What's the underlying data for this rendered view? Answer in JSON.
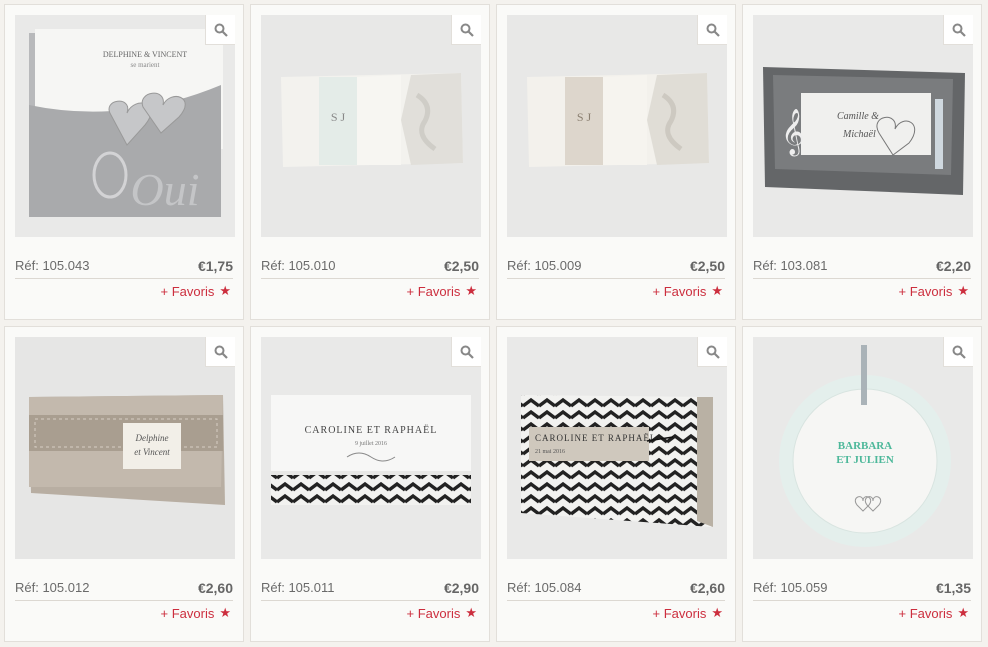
{
  "products": [
    {
      "ref": "Réf: 105.043",
      "price": "€1,75",
      "fav": "+ Favoris",
      "img": {
        "t1": "DELPHINE & VINCENT",
        "t2": "se marient",
        "t3": "Oui"
      }
    },
    {
      "ref": "Réf: 105.010",
      "price": "€2,50",
      "fav": "+ Favoris",
      "img": {
        "t1": "S J"
      }
    },
    {
      "ref": "Réf: 105.009",
      "price": "€2,50",
      "fav": "+ Favoris",
      "img": {
        "t1": "S J"
      }
    },
    {
      "ref": "Réf: 103.081",
      "price": "€2,20",
      "fav": "+ Favoris",
      "img": {
        "t1": "Camille &",
        "t2": "Michaël"
      }
    },
    {
      "ref": "Réf: 105.012",
      "price": "€2,60",
      "fav": "+ Favoris",
      "img": {
        "t1": "Delphine",
        "t2": "et Vincent"
      }
    },
    {
      "ref": "Réf: 105.011",
      "price": "€2,90",
      "fav": "+ Favoris",
      "img": {
        "t1": "CAROLINE ET RAPHAËL",
        "t2": "9 juillet 2016"
      }
    },
    {
      "ref": "Réf: 105.084",
      "price": "€2,60",
      "fav": "+ Favoris",
      "img": {
        "t1": "CAROLINE ET RAPHAËL",
        "t2": "21 mai 2016"
      }
    },
    {
      "ref": "Réf: 105.059",
      "price": "€1,35",
      "fav": "+ Favoris",
      "img": {
        "t1": "BARBARA",
        "t2": "ET JULIEN"
      }
    }
  ],
  "colors": {
    "favorite": "#cc2e3e",
    "price": "#666666",
    "card_border": "#e2dfda"
  },
  "icons": {
    "zoom": "magnifier-icon",
    "favorite": "star-icon"
  }
}
